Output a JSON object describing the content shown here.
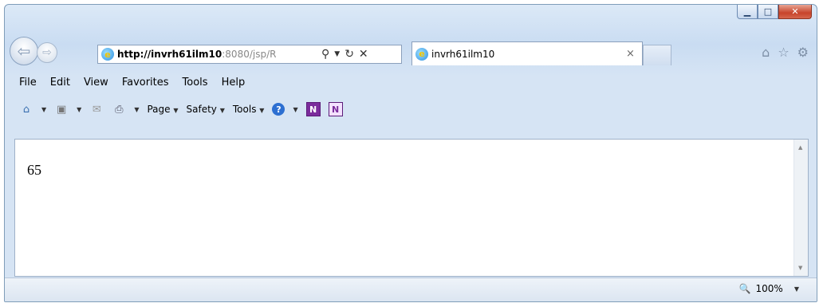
{
  "address_bar": {
    "url_host": "http://invrh61ilm10",
    "url_rest": ":8080/jsp/R",
    "search_icon": "search-icon",
    "refresh_icon": "refresh-icon",
    "stop_icon": "stop-icon"
  },
  "tab": {
    "title": "invrh61ilm10",
    "close": "×"
  },
  "menu": {
    "file": "File",
    "edit": "Edit",
    "view": "View",
    "favorites": "Favorites",
    "tools": "Tools",
    "help": "Help"
  },
  "command_bar": {
    "page": "Page",
    "safety": "Safety",
    "tools": "Tools"
  },
  "content": {
    "text": "65"
  },
  "status": {
    "zoom": "100%"
  }
}
